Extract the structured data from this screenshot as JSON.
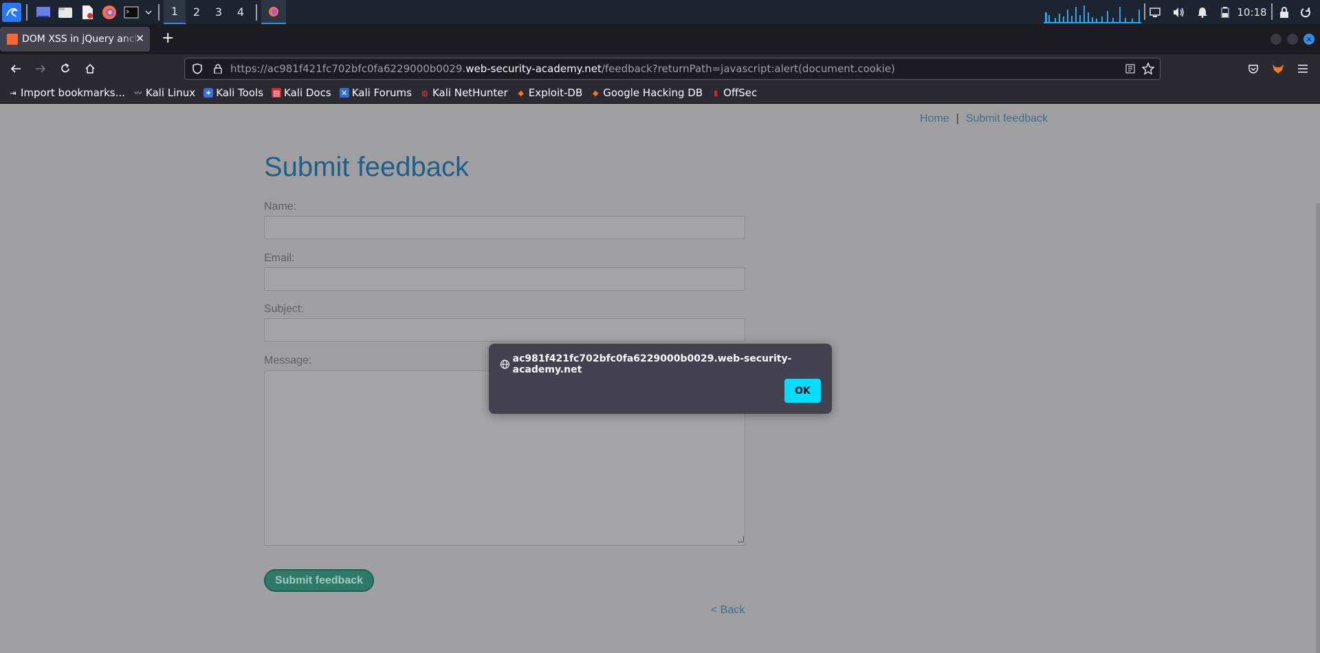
{
  "panel": {
    "workspaces": [
      "1",
      "2",
      "3",
      "4"
    ],
    "active_workspace": "1",
    "clock": "10:18",
    "icons": [
      "kali-menu-icon",
      "desktop-icon",
      "file-manager-icon",
      "text-editor-icon",
      "firefox-icon",
      "terminal-icon",
      "chevron-down-icon",
      "network-graph",
      "display-icon",
      "volume-icon",
      "notifications-icon",
      "battery-icon",
      "lock-icon",
      "power-icon"
    ]
  },
  "browser": {
    "tab_title": "DOM XSS in jQuery anchor href attribute sink using location.search source",
    "url_prefix": "https://ac981f421fc702bfc0fa6229000b0029.",
    "url_host": "web-security-academy.net",
    "url_path": "/feedback?returnPath=javascript:alert(document.cookie)",
    "bookmarks": [
      {
        "label": "Import bookmarks...",
        "icon": "import-icon"
      },
      {
        "label": "Kali Linux",
        "icon": "kali-dragon-icon"
      },
      {
        "label": "Kali Tools",
        "icon": "kali-tools-icon"
      },
      {
        "label": "Kali Docs",
        "icon": "kali-docs-icon"
      },
      {
        "label": "Kali Forums",
        "icon": "kali-forums-icon"
      },
      {
        "label": "Kali NetHunter",
        "icon": "nethunter-icon"
      },
      {
        "label": "Exploit-DB",
        "icon": "exploit-db-icon"
      },
      {
        "label": "Google Hacking DB",
        "icon": "ghdb-icon"
      },
      {
        "label": "OffSec",
        "icon": "offsec-icon"
      }
    ]
  },
  "page": {
    "nav": {
      "home": "Home",
      "separator": "|",
      "feedback": "Submit feedback"
    },
    "heading": "Submit feedback",
    "labels": {
      "name": "Name:",
      "email": "Email:",
      "subject": "Subject:",
      "message": "Message:"
    },
    "submit_label": "Submit feedback",
    "back_label": "< Back"
  },
  "dialog": {
    "origin": "ac981f421fc702bfc0fa6229000b0029.web-security-academy.net",
    "ok_label": "OK"
  },
  "colors": {
    "accent": "#00ddff",
    "link": "#3b6f8f",
    "heading": "#1c5f8a",
    "button": "#2c7a67"
  }
}
